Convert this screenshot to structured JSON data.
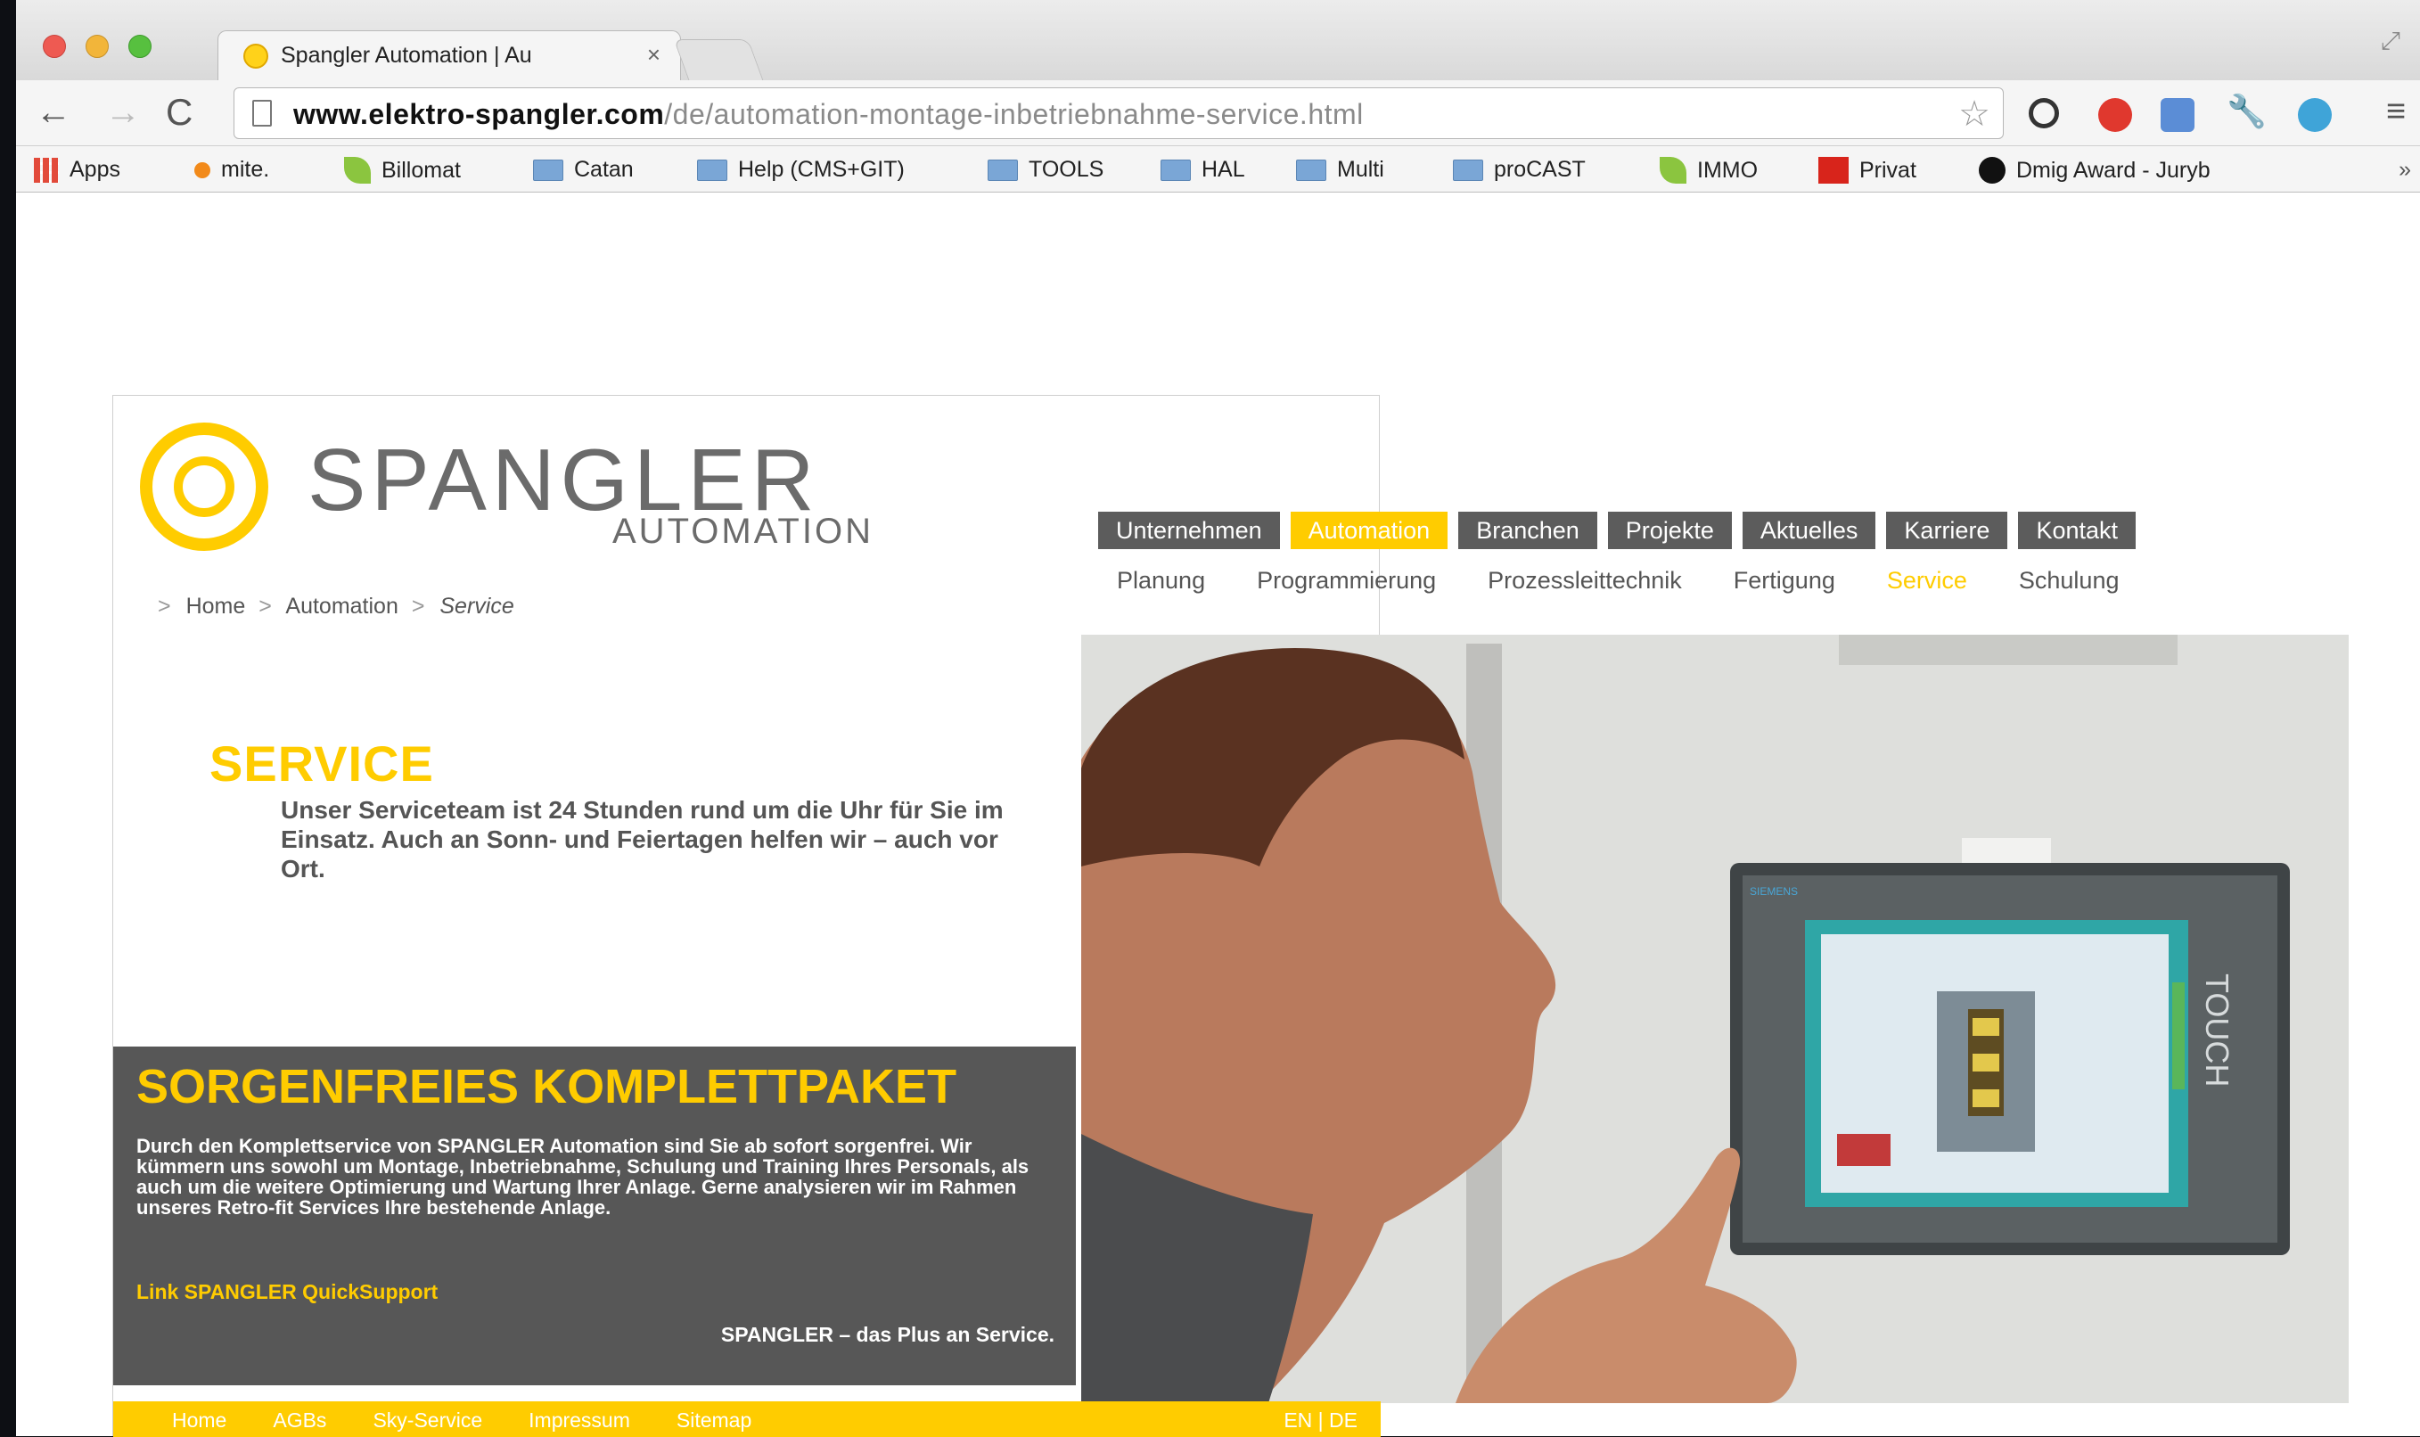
{
  "browser": {
    "tab_title": "Spangler Automation | Au",
    "tab_close": "×",
    "url_host": "www.elektro-spangler.com",
    "url_path": "/de/automation-montage-inbetriebnahme-service.html",
    "back_icon": "←",
    "forward_icon": "→",
    "reload_icon": "C",
    "star_icon": "☆",
    "menu_icon": "≡",
    "bookmarks": [
      {
        "label": "Apps",
        "icon": "apps-grid"
      },
      {
        "label": "mite.",
        "icon": "orange-dot"
      },
      {
        "label": "Billomat",
        "icon": "leaf"
      },
      {
        "label": "Catan",
        "icon": "folder"
      },
      {
        "label": "Help (CMS+GIT)",
        "icon": "folder"
      },
      {
        "label": "TOOLS",
        "icon": "folder"
      },
      {
        "label": "HAL",
        "icon": "folder"
      },
      {
        "label": "Multi",
        "icon": "folder"
      },
      {
        "label": "proCAST",
        "icon": "folder"
      },
      {
        "label": "IMMO",
        "icon": "leaf"
      },
      {
        "label": "Privat",
        "icon": "red-square"
      },
      {
        "label": "Dmig Award - Juryb",
        "icon": "apple"
      }
    ],
    "bookmarks_more": "»"
  },
  "site": {
    "logo_name": "SPANGLER",
    "logo_sub": "AUTOMATION",
    "breadcrumb": {
      "sep": ">",
      "items": [
        "Home",
        "Automation",
        "Service"
      ]
    },
    "main_nav": [
      "Unternehmen",
      "Automation",
      "Branchen",
      "Projekte",
      "Aktuelles",
      "Karriere",
      "Kontakt"
    ],
    "main_nav_active": "Automation",
    "sub_nav": [
      "Planung",
      "Programmierung",
      "Prozessleittechnik",
      "Fertigung",
      "Service",
      "Schulung"
    ],
    "sub_nav_active": "Service",
    "service_title": "SERVICE",
    "service_text": "Unser Serviceteam ist 24 Stunden rund um die Uhr für Sie im Einsatz. Auch an Sonn- und Feiertagen helfen wir – auch vor Ort.",
    "package_title": "SORGENFREIES KOMPLETTPAKET",
    "package_text": "Durch den Komplettservice von SPANGLER Automation sind Sie ab sofort sorgenfrei. Wir kümmern uns sowohl um Montage, Inbetriebnahme, Schulung und Training Ihres Personals, als auch um die weitere Optimierung und Wartung Ihrer Anlage. Gerne analysieren wir im Rahmen unseres Retro-fit Services Ihre bestehende Anlage.",
    "package_link": "Link SPANGLER QuickSupport",
    "package_slogan": "SPANGLER – das Plus an Service.",
    "footer_links": [
      "Home",
      "AGBs",
      "Sky-Service",
      "Impressum",
      "Sitemap"
    ],
    "footer_lang": "EN | DE",
    "touch_label": "TOUCH",
    "panel_brand": "SIEMENS"
  },
  "colors": {
    "brand_yellow": "#ffcc00",
    "nav_grey": "#5c5c5c",
    "box_grey": "#575757"
  }
}
